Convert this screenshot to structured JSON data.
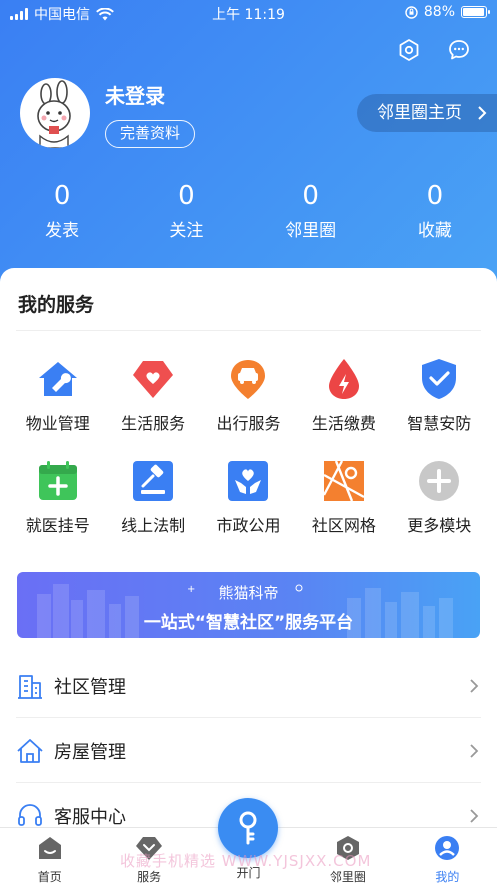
{
  "status_bar": {
    "carrier": "中国电信",
    "time": "上午 11:19",
    "battery": "88%",
    "battery_level": 0.88
  },
  "header": {
    "username": "未登录",
    "complete_profile": "完善资料",
    "circle_home": "邻里圈主页",
    "stats": [
      {
        "value": "0",
        "label": "发表"
      },
      {
        "value": "0",
        "label": "关注"
      },
      {
        "value": "0",
        "label": "邻里圈"
      },
      {
        "value": "0",
        "label": "收藏"
      }
    ]
  },
  "services": {
    "title": "我的服务",
    "items": [
      {
        "label": "物业管理",
        "icon": "house-wrench-icon",
        "color": "#3a7ff3"
      },
      {
        "label": "生活服务",
        "icon": "heart-hands-icon",
        "color": "#ef4f4f"
      },
      {
        "label": "出行服务",
        "icon": "car-icon",
        "color": "#f4802f"
      },
      {
        "label": "生活缴费",
        "icon": "flame-drop-icon",
        "color": "#ec4545"
      },
      {
        "label": "智慧安防",
        "icon": "shield-check-icon",
        "color": "#3a7ff3"
      },
      {
        "label": "就医挂号",
        "icon": "medical-calendar-icon",
        "color": "#3fc55a"
      },
      {
        "label": "线上法制",
        "icon": "gavel-icon",
        "color": "#3a7ff3"
      },
      {
        "label": "市政公用",
        "icon": "hands-heart-icon",
        "color": "#3a7ff3"
      },
      {
        "label": "社区网格",
        "icon": "map-grid-icon",
        "color": "#f4802f"
      },
      {
        "label": "更多模块",
        "icon": "plus-circle-icon",
        "color": "#c8c8c8"
      }
    ]
  },
  "banner": {
    "brand": "熊猫科帝",
    "slogan": "一站式“智慧社区”服务平台"
  },
  "list": [
    {
      "label": "社区管理",
      "icon": "building-icon"
    },
    {
      "label": "房屋管理",
      "icon": "house-icon"
    },
    {
      "label": "客服中心",
      "icon": "headset-icon"
    }
  ],
  "tabbar": {
    "items": [
      {
        "label": "首页",
        "icon": "home-icon"
      },
      {
        "label": "服务",
        "icon": "service-icon"
      },
      {
        "label": "开门",
        "icon": "key-icon"
      },
      {
        "label": "邻里圈",
        "icon": "neighbor-icon"
      },
      {
        "label": "我的",
        "icon": "profile-icon"
      }
    ],
    "active": "我的"
  },
  "watermark": "收藏手机精选 WWW.YJSJXX.COM"
}
